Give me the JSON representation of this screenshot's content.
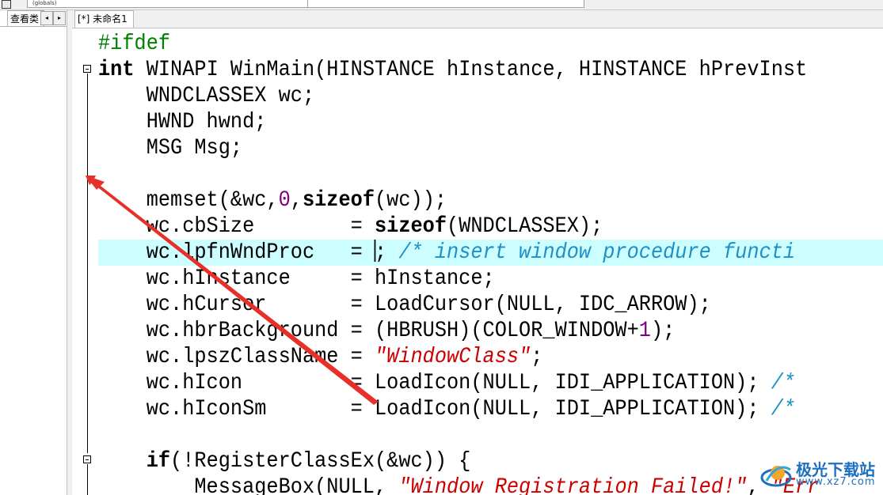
{
  "toolbar": {
    "combo_left": "(globals)"
  },
  "left_panel": {
    "tab_label": "查看类",
    "scroll_left": "◂",
    "scroll_right": "▸"
  },
  "editor": {
    "tab_label": "[*] 未命名1",
    "current_line_index": 8,
    "lines": [
      [
        {
          "t": "#ifdef",
          "c": "pp"
        }
      ],
      [
        {
          "t": "int",
          "c": "kw"
        },
        {
          "t": " WINAPI WinMain(HINSTANCE hInstance, HINSTANCE hPrevInst"
        }
      ],
      [
        {
          "t": "    WNDCLASSEX wc;"
        }
      ],
      [
        {
          "t": "    HWND hwnd;"
        }
      ],
      [
        {
          "t": "    MSG Msg;"
        }
      ],
      [
        {
          "t": ""
        }
      ],
      [
        {
          "t": "    memset(&wc,"
        },
        {
          "t": "0",
          "c": "num"
        },
        {
          "t": ","
        },
        {
          "t": "sizeof",
          "c": "kw"
        },
        {
          "t": "(wc));"
        }
      ],
      [
        {
          "t": "    wc.cbSize        = "
        },
        {
          "t": "sizeof",
          "c": "kw"
        },
        {
          "t": "(WNDCLASSEX);"
        }
      ],
      [
        {
          "t": "    wc.lpfnWndProc   = "
        },
        {
          "t": "",
          "c": "cursor"
        },
        {
          "t": "; "
        },
        {
          "t": "/* insert window procedure functi",
          "c": "cm"
        }
      ],
      [
        {
          "t": "    wc.hInstance     = hInstance;"
        }
      ],
      [
        {
          "t": "    wc.hCursor       = LoadCursor(NULL, IDC_ARROW);"
        }
      ],
      [
        {
          "t": "    wc.hbrBackground = (HBRUSH)(COLOR_WINDOW+"
        },
        {
          "t": "1",
          "c": "num"
        },
        {
          "t": ");"
        }
      ],
      [
        {
          "t": "    wc.lpszClassName = "
        },
        {
          "t": "\"WindowClass\"",
          "c": "str"
        },
        {
          "t": ";"
        }
      ],
      [
        {
          "t": "    wc.hIcon         = LoadIcon(NULL, IDI_APPLICATION); "
        },
        {
          "t": "/*",
          "c": "cm"
        }
      ],
      [
        {
          "t": "    wc.hIconSm       = LoadIcon(NULL, IDI_APPLICATION); "
        },
        {
          "t": "/*",
          "c": "cm"
        }
      ],
      [
        {
          "t": ""
        }
      ],
      [
        {
          "t": "    "
        },
        {
          "t": "if",
          "c": "kw"
        },
        {
          "t": "(!RegisterClassEx(&wc)) {"
        }
      ],
      [
        {
          "t": "        MessageBox(NULL, "
        },
        {
          "t": "\"Window Registration Failed!\"",
          "c": "str"
        },
        {
          "t": ", "
        },
        {
          "t": "\"Err",
          "c": "str"
        }
      ]
    ]
  },
  "watermark": {
    "title": "极光下载站",
    "url": "www.xz7.com"
  },
  "colors": {
    "current_line_bg": "#ccfeff",
    "preprocessor": "#008000",
    "number": "#800080",
    "string": "#cc0000",
    "comment": "#1e90c8",
    "annotation_arrow": "#e8302a"
  }
}
